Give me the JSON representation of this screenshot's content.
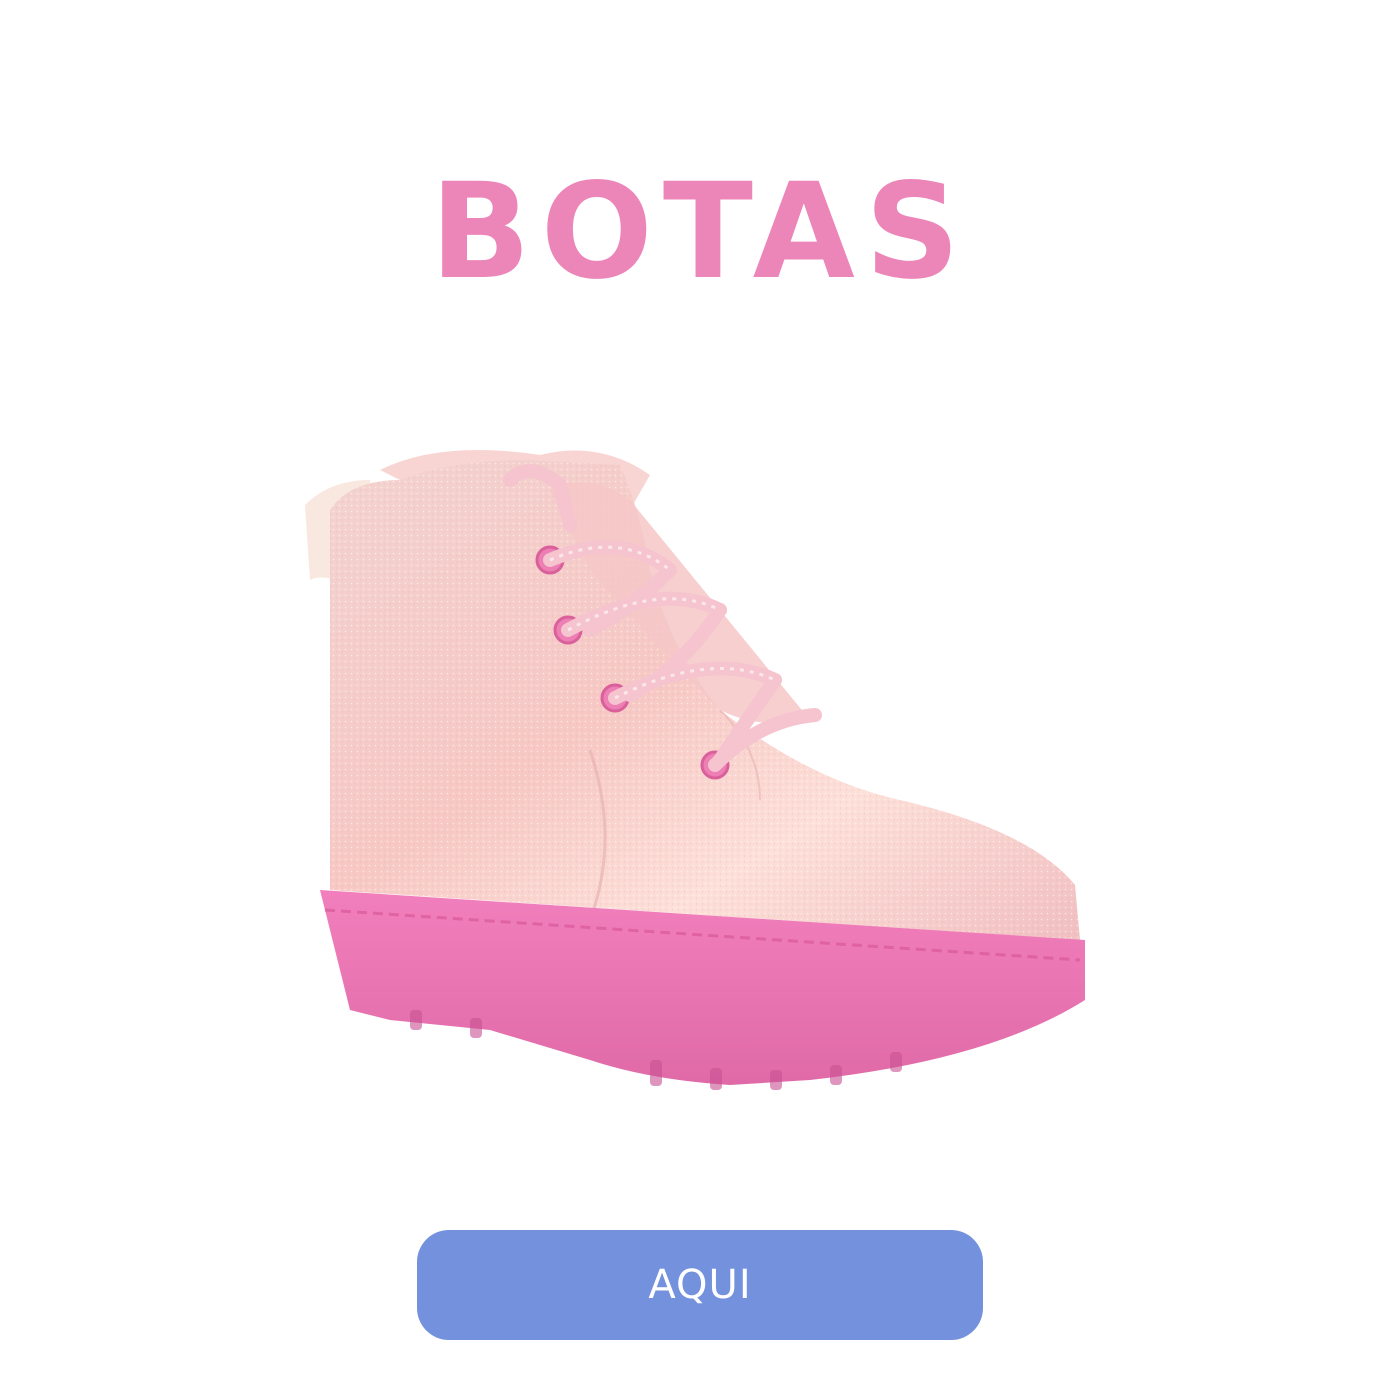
{
  "header": {
    "title": "BOTAS"
  },
  "product": {
    "image_icon": "pink-glitter-boot-illustration"
  },
  "cta": {
    "label": "AQUI"
  },
  "colors": {
    "title": "#ec86b9",
    "button": "#7391dc",
    "button_text": "#ffffff",
    "boot_upper": "#f6c9c6",
    "boot_sole": "#ee79b6"
  }
}
